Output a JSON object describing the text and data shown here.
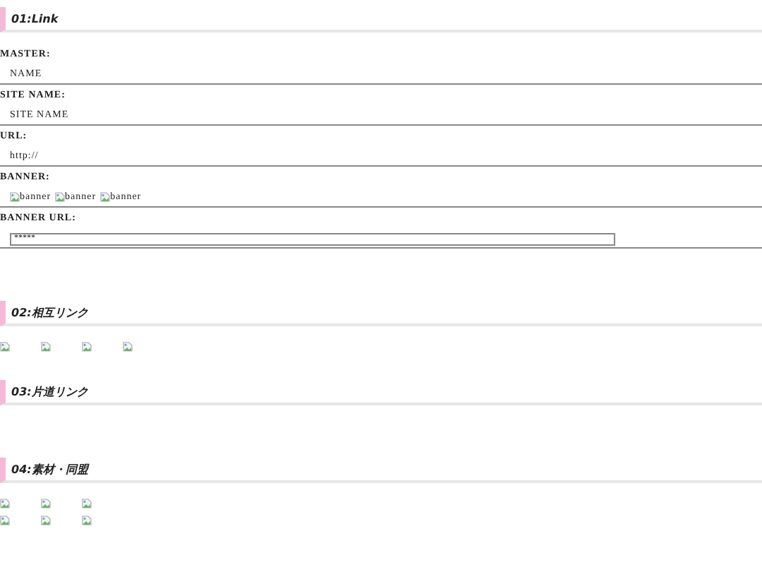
{
  "sections": [
    {
      "heading": "01:Link",
      "fields": [
        {
          "label": "MASTER:",
          "kind": "text",
          "value": "NAME"
        },
        {
          "label": "SITE NAME:",
          "kind": "text",
          "value": "SITE NAME"
        },
        {
          "label": "URL:",
          "kind": "text",
          "value": "http://"
        },
        {
          "label": "BANNER:",
          "kind": "banners",
          "banners": [
            "banner",
            "banner",
            "banner"
          ]
        },
        {
          "label": "BANNER URL:",
          "kind": "input",
          "value": "*****"
        }
      ]
    },
    {
      "heading": "02:相互リンク",
      "image_rows": [
        [
          {
            "kind": "broken-image"
          },
          {
            "kind": "broken-image"
          },
          {
            "kind": "broken-image"
          },
          {
            "kind": "broken-image"
          }
        ]
      ]
    },
    {
      "heading": "03:片道リンク"
    },
    {
      "heading": "04:素材・同盟",
      "image_rows": [
        [
          {
            "kind": "broken-image"
          },
          {
            "kind": "broken-image"
          },
          {
            "kind": "broken-image"
          }
        ],
        [
          {
            "kind": "broken-image"
          },
          {
            "kind": "broken-image"
          },
          {
            "kind": "broken-image"
          }
        ]
      ]
    }
  ]
}
